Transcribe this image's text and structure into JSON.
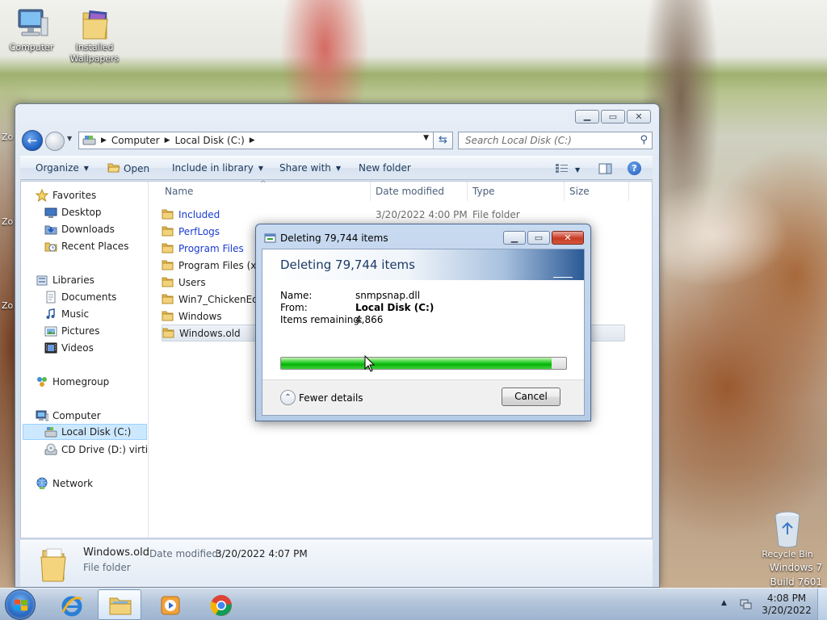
{
  "desktop": {
    "icons": [
      {
        "label": "Computer",
        "icon": "computer-icon"
      },
      {
        "label": "Installed Wallpapers",
        "icon": "wallpaper-folder-icon"
      }
    ],
    "recycle_bin": "Recycle Bin",
    "edge_marks": [
      "Zo",
      "Zo",
      "Zo"
    ],
    "watermark_line1": "Windows 7",
    "watermark_line2": "Build 7601"
  },
  "explorer": {
    "breadcrumb": [
      "Computer",
      "Local Disk (C:)"
    ],
    "search_placeholder": "Search Local Disk (C:)",
    "commands": {
      "organize": "Organize",
      "open": "Open",
      "include_in_library": "Include in library",
      "share_with": "Share with",
      "new_folder": "New folder"
    },
    "nav": {
      "favorites": "Favorites",
      "desktop": "Desktop",
      "downloads": "Downloads",
      "recent_places": "Recent Places",
      "libraries": "Libraries",
      "documents": "Documents",
      "music": "Music",
      "pictures": "Pictures",
      "videos": "Videos",
      "homegroup": "Homegroup",
      "computer": "Computer",
      "local_disk": "Local Disk (C:)",
      "cd_drive": "CD Drive (D:) virtio-w",
      "network": "Network"
    },
    "columns": {
      "name": "Name",
      "date": "Date modified",
      "type": "Type",
      "size": "Size"
    },
    "files": [
      {
        "name": "Included",
        "date": "3/20/2022 4:00 PM",
        "type": "File folder",
        "blue": true
      },
      {
        "name": "PerfLogs",
        "date": "",
        "type": "",
        "blue": true
      },
      {
        "name": "Program Files",
        "date": "",
        "type": "",
        "blue": true
      },
      {
        "name": "Program Files (x86",
        "date": "",
        "type": "",
        "blue": false
      },
      {
        "name": "Users",
        "date": "",
        "type": "",
        "blue": false
      },
      {
        "name": "Win7_ChickenEdit",
        "date": "",
        "type": "",
        "blue": false
      },
      {
        "name": "Windows",
        "date": "",
        "type": "",
        "blue": false
      },
      {
        "name": "Windows.old",
        "date": "",
        "type": "",
        "blue": false
      }
    ],
    "details": {
      "name": "Windows.old",
      "modified_label": "Date modified:",
      "modified_value": "3/20/2022 4:07 PM",
      "type": "File folder"
    }
  },
  "dialog": {
    "title": "Deleting 79,744 items",
    "heading": "Deleting 79,744 items",
    "name_label": "Name:",
    "name_value": "snmpsnap.dll",
    "from_label": "From:",
    "from_value": "Local Disk (C:)",
    "remaining_label": "Items remaining:",
    "remaining_value": "4,866",
    "progress": 0.95,
    "fewer_details": "Fewer details",
    "cancel": "Cancel"
  },
  "taskbar": {
    "time": "4:08 PM",
    "date": "3/20/2022",
    "apps": [
      "internet-explorer-icon",
      "windows-explorer-icon",
      "media-player-icon",
      "chrome-icon"
    ]
  }
}
